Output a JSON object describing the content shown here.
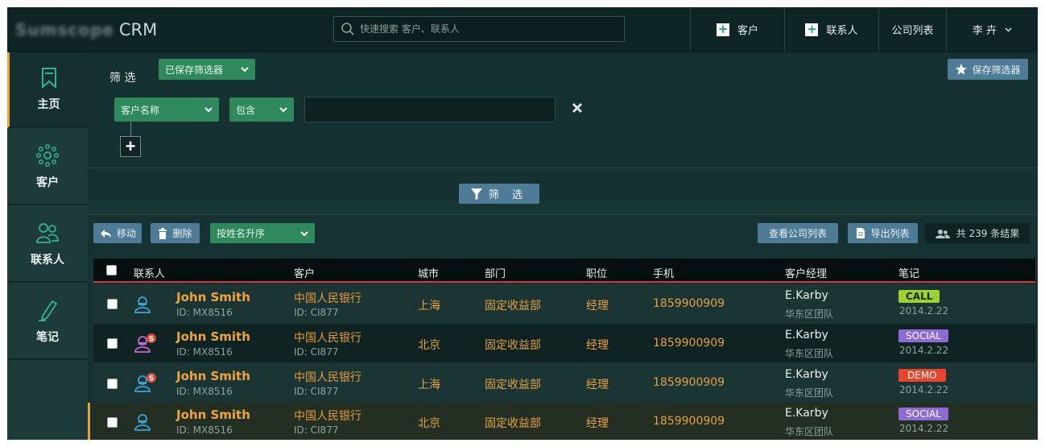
{
  "header": {
    "logo_text": "Sumscope",
    "app_name": "CRM",
    "search_placeholder": "快速搜索 客户、联系人",
    "add_customer": "客户",
    "add_contact": "联系人",
    "company_list": "公司列表",
    "user_name": "李 卉"
  },
  "sidebar": {
    "items": [
      {
        "label": "主页",
        "icon": "bookmark-icon"
      },
      {
        "label": "客户",
        "icon": "dots-circle-icon"
      },
      {
        "label": "联系人",
        "icon": "people-icon"
      },
      {
        "label": "笔记",
        "icon": "pen-icon"
      }
    ]
  },
  "filter": {
    "title": "筛 选",
    "saved_filters": "已保存筛选器",
    "save_filter": "保存筛选器",
    "field": "客户名称",
    "operator": "包含",
    "value": "",
    "run": "筛 选"
  },
  "toolbar": {
    "move": "移动",
    "delete": "删除",
    "sort": "按姓名升序",
    "view_company_list": "查看公司列表",
    "export_list": "导出列表",
    "result_count": "共 239 条结果"
  },
  "table": {
    "columns": [
      "联系人",
      "客户",
      "城市",
      "部门",
      "职位",
      "手机",
      "客户经理",
      "笔记"
    ],
    "rows": [
      {
        "name": "John Smith",
        "id": "ID: MX8516",
        "customer": "中国人民银行",
        "customer_id": "ID: CI877",
        "city": "上海",
        "dept": "固定收益部",
        "title": "经理",
        "phone": "1859900909",
        "manager": "E.Karby",
        "team": "华东区团队",
        "tag": "CALL",
        "date": "2014.2.22"
      },
      {
        "name": "John Smith",
        "id": "ID: MX8516",
        "customer": "中国人民银行",
        "customer_id": "ID: CI877",
        "city": "北京",
        "dept": "固定收益部",
        "title": "经理",
        "phone": "1859900909",
        "manager": "E.Karby",
        "team": "华东区团队",
        "tag": "SOCIAL",
        "date": "2014.2.22"
      },
      {
        "name": "John Smith",
        "id": "ID: MX8516",
        "customer": "中国人民银行",
        "customer_id": "ID: CI877",
        "city": "上海",
        "dept": "固定收益部",
        "title": "经理",
        "phone": "1859900909",
        "manager": "E.Karby",
        "team": "华东区团队",
        "tag": "DEMO",
        "date": "2014.2.22"
      },
      {
        "name": "John Smith",
        "id": "ID: MX8516",
        "customer": "中国人民银行",
        "customer_id": "ID: CI877",
        "city": "北京",
        "dept": "固定收益部",
        "title": "经理",
        "phone": "1859900909",
        "manager": "E.Karby",
        "team": "华东区团队",
        "tag": "SOCIAL",
        "date": "2014.2.22"
      }
    ],
    "avatar_badge": "S"
  },
  "colors": {
    "accent_orange": "#f0a030",
    "primary_green": "#2e8a5d",
    "button_blue": "#4e7b95",
    "header_rule": "#d03a36",
    "tag_call": "#9cd134",
    "tag_social": "#8e6ad4",
    "tag_demo": "#e8452f"
  }
}
